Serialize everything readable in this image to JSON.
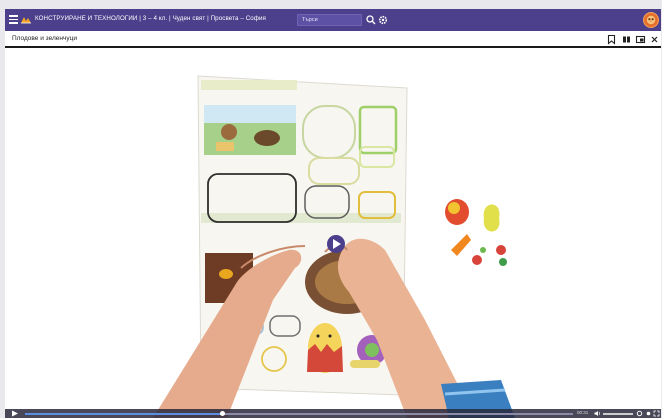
{
  "header": {
    "app_title": "КОНСТРУИРАНЕ И ТЕХНОЛОГИИ | 3 – 4 кл. | Чуден свят | Просвета – София",
    "search_placeholder": "Търси"
  },
  "subheader": {
    "lesson_title": "Плодове и зеленчуци"
  },
  "player": {
    "time": "00:31",
    "progress": 0.36,
    "volume": 1.0
  },
  "colors": {
    "brand": "#4c3f8c",
    "progress": "#5b8de0"
  }
}
